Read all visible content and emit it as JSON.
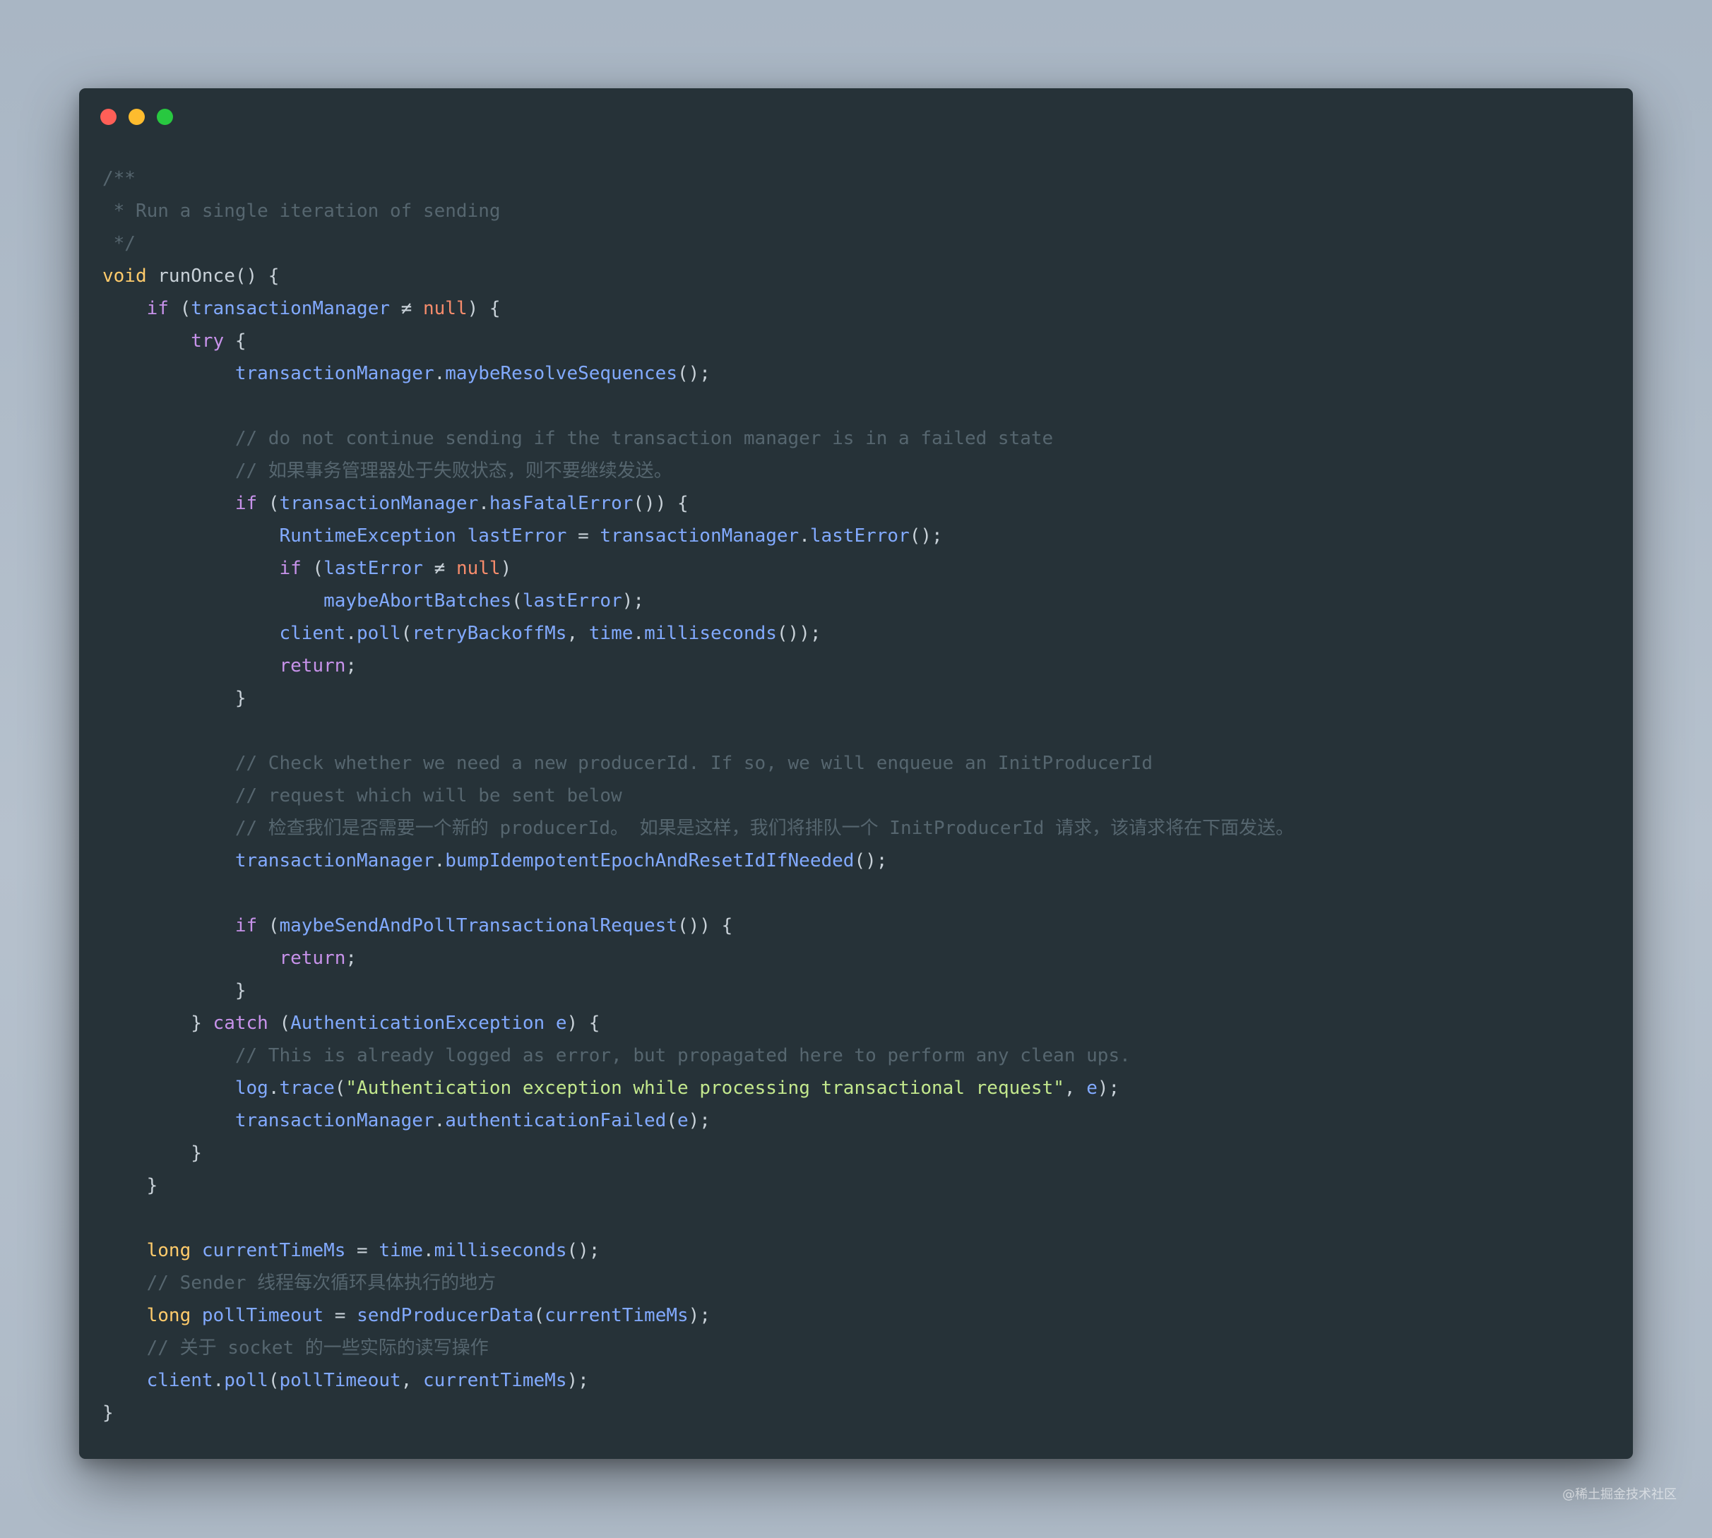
{
  "window": {
    "controls": [
      "close",
      "minimize",
      "maximize"
    ],
    "code_language": "java"
  },
  "code_lines": [
    [
      {
        "t": "/**",
        "c": "cm"
      }
    ],
    [
      {
        "t": " * Run a single iteration of sending",
        "c": "cm"
      }
    ],
    [
      {
        "t": " */",
        "c": "cm"
      }
    ],
    [
      {
        "t": "void",
        "c": "ty"
      },
      {
        "t": " runOnce() {",
        "c": "pn"
      }
    ],
    [
      {
        "t": "    ",
        "c": "pn"
      },
      {
        "t": "if",
        "c": "kw"
      },
      {
        "t": " (",
        "c": "pn"
      },
      {
        "t": "transactionManager",
        "c": "id"
      },
      {
        "t": " ≠ ",
        "c": "pn"
      },
      {
        "t": "null",
        "c": "nl"
      },
      {
        "t": ") {",
        "c": "pn"
      }
    ],
    [
      {
        "t": "        ",
        "c": "pn"
      },
      {
        "t": "try",
        "c": "kw"
      },
      {
        "t": " {",
        "c": "pn"
      }
    ],
    [
      {
        "t": "            ",
        "c": "pn"
      },
      {
        "t": "transactionManager",
        "c": "id"
      },
      {
        "t": ".",
        "c": "pn"
      },
      {
        "t": "maybeResolveSequences",
        "c": "id"
      },
      {
        "t": "();",
        "c": "pn"
      }
    ],
    [],
    [
      {
        "t": "            // do not continue sending if the transaction manager is in a failed state",
        "c": "cm"
      }
    ],
    [
      {
        "t": "            // 如果事务管理器处于失败状态，则不要继续发送。",
        "c": "cm"
      }
    ],
    [
      {
        "t": "            ",
        "c": "pn"
      },
      {
        "t": "if",
        "c": "kw"
      },
      {
        "t": " (",
        "c": "pn"
      },
      {
        "t": "transactionManager",
        "c": "id"
      },
      {
        "t": ".",
        "c": "pn"
      },
      {
        "t": "hasFatalError",
        "c": "id"
      },
      {
        "t": "()) {",
        "c": "pn"
      }
    ],
    [
      {
        "t": "                ",
        "c": "pn"
      },
      {
        "t": "RuntimeException",
        "c": "id"
      },
      {
        "t": " ",
        "c": "pn"
      },
      {
        "t": "lastError",
        "c": "id"
      },
      {
        "t": " = ",
        "c": "pn"
      },
      {
        "t": "transactionManager",
        "c": "id"
      },
      {
        "t": ".",
        "c": "pn"
      },
      {
        "t": "lastError",
        "c": "id"
      },
      {
        "t": "();",
        "c": "pn"
      }
    ],
    [
      {
        "t": "                ",
        "c": "pn"
      },
      {
        "t": "if",
        "c": "kw"
      },
      {
        "t": " (",
        "c": "pn"
      },
      {
        "t": "lastError",
        "c": "id"
      },
      {
        "t": " ≠ ",
        "c": "pn"
      },
      {
        "t": "null",
        "c": "nl"
      },
      {
        "t": ")",
        "c": "pn"
      }
    ],
    [
      {
        "t": "                    ",
        "c": "pn"
      },
      {
        "t": "maybeAbortBatches",
        "c": "id"
      },
      {
        "t": "(",
        "c": "pn"
      },
      {
        "t": "lastError",
        "c": "id"
      },
      {
        "t": ");",
        "c": "pn"
      }
    ],
    [
      {
        "t": "                ",
        "c": "pn"
      },
      {
        "t": "client",
        "c": "id"
      },
      {
        "t": ".",
        "c": "pn"
      },
      {
        "t": "poll",
        "c": "id"
      },
      {
        "t": "(",
        "c": "pn"
      },
      {
        "t": "retryBackoffMs",
        "c": "id"
      },
      {
        "t": ", ",
        "c": "pn"
      },
      {
        "t": "time",
        "c": "id"
      },
      {
        "t": ".",
        "c": "pn"
      },
      {
        "t": "milliseconds",
        "c": "id"
      },
      {
        "t": "());",
        "c": "pn"
      }
    ],
    [
      {
        "t": "                ",
        "c": "pn"
      },
      {
        "t": "return",
        "c": "kw"
      },
      {
        "t": ";",
        "c": "pn"
      }
    ],
    [
      {
        "t": "            }",
        "c": "pn"
      }
    ],
    [],
    [
      {
        "t": "            // Check whether we need a new producerId. If so, we will enqueue an InitProducerId",
        "c": "cm"
      }
    ],
    [
      {
        "t": "            // request which will be sent below",
        "c": "cm"
      }
    ],
    [
      {
        "t": "            // 检查我们是否需要一个新的 producerId。 如果是这样，我们将排队一个 InitProducerId 请求，该请求将在下面发送。",
        "c": "cm"
      }
    ],
    [
      {
        "t": "            ",
        "c": "pn"
      },
      {
        "t": "transactionManager",
        "c": "id"
      },
      {
        "t": ".",
        "c": "pn"
      },
      {
        "t": "bumpIdempotentEpochAndResetIdIfNeeded",
        "c": "id"
      },
      {
        "t": "();",
        "c": "pn"
      }
    ],
    [],
    [
      {
        "t": "            ",
        "c": "pn"
      },
      {
        "t": "if",
        "c": "kw"
      },
      {
        "t": " (",
        "c": "pn"
      },
      {
        "t": "maybeSendAndPollTransactionalRequest",
        "c": "id"
      },
      {
        "t": "()) {",
        "c": "pn"
      }
    ],
    [
      {
        "t": "                ",
        "c": "pn"
      },
      {
        "t": "return",
        "c": "kw"
      },
      {
        "t": ";",
        "c": "pn"
      }
    ],
    [
      {
        "t": "            }",
        "c": "pn"
      }
    ],
    [
      {
        "t": "        } ",
        "c": "pn"
      },
      {
        "t": "catch",
        "c": "kw"
      },
      {
        "t": " (",
        "c": "pn"
      },
      {
        "t": "AuthenticationException",
        "c": "id"
      },
      {
        "t": " ",
        "c": "pn"
      },
      {
        "t": "e",
        "c": "id"
      },
      {
        "t": ") {",
        "c": "pn"
      }
    ],
    [
      {
        "t": "            // This is already logged as error, but propagated here to perform any clean ups.",
        "c": "cm"
      }
    ],
    [
      {
        "t": "            ",
        "c": "pn"
      },
      {
        "t": "log",
        "c": "id"
      },
      {
        "t": ".",
        "c": "pn"
      },
      {
        "t": "trace",
        "c": "id"
      },
      {
        "t": "(",
        "c": "pn"
      },
      {
        "t": "\"Authentication exception while processing transactional request\"",
        "c": "st"
      },
      {
        "t": ", ",
        "c": "pn"
      },
      {
        "t": "e",
        "c": "id"
      },
      {
        "t": ");",
        "c": "pn"
      }
    ],
    [
      {
        "t": "            ",
        "c": "pn"
      },
      {
        "t": "transactionManager",
        "c": "id"
      },
      {
        "t": ".",
        "c": "pn"
      },
      {
        "t": "authenticationFailed",
        "c": "id"
      },
      {
        "t": "(",
        "c": "pn"
      },
      {
        "t": "e",
        "c": "id"
      },
      {
        "t": ");",
        "c": "pn"
      }
    ],
    [
      {
        "t": "        }",
        "c": "pn"
      }
    ],
    [
      {
        "t": "    }",
        "c": "pn"
      }
    ],
    [],
    [
      {
        "t": "    ",
        "c": "pn"
      },
      {
        "t": "long",
        "c": "ty"
      },
      {
        "t": " ",
        "c": "pn"
      },
      {
        "t": "currentTimeMs",
        "c": "id"
      },
      {
        "t": " = ",
        "c": "pn"
      },
      {
        "t": "time",
        "c": "id"
      },
      {
        "t": ".",
        "c": "pn"
      },
      {
        "t": "milliseconds",
        "c": "id"
      },
      {
        "t": "();",
        "c": "pn"
      }
    ],
    [
      {
        "t": "    // Sender 线程每次循环具体执行的地方",
        "c": "cm"
      }
    ],
    [
      {
        "t": "    ",
        "c": "pn"
      },
      {
        "t": "long",
        "c": "ty"
      },
      {
        "t": " ",
        "c": "pn"
      },
      {
        "t": "pollTimeout",
        "c": "id"
      },
      {
        "t": " = ",
        "c": "pn"
      },
      {
        "t": "sendProducerData",
        "c": "id"
      },
      {
        "t": "(",
        "c": "pn"
      },
      {
        "t": "currentTimeMs",
        "c": "id"
      },
      {
        "t": ");",
        "c": "pn"
      }
    ],
    [
      {
        "t": "    // 关于 socket 的一些实际的读写操作",
        "c": "cm"
      }
    ],
    [
      {
        "t": "    ",
        "c": "pn"
      },
      {
        "t": "client",
        "c": "id"
      },
      {
        "t": ".",
        "c": "pn"
      },
      {
        "t": "poll",
        "c": "id"
      },
      {
        "t": "(",
        "c": "pn"
      },
      {
        "t": "pollTimeout",
        "c": "id"
      },
      {
        "t": ", ",
        "c": "pn"
      },
      {
        "t": "currentTimeMs",
        "c": "id"
      },
      {
        "t": ");",
        "c": "pn"
      }
    ],
    [
      {
        "t": "}",
        "c": "pn"
      }
    ]
  ],
  "watermark": "@稀土掘金技术社区"
}
